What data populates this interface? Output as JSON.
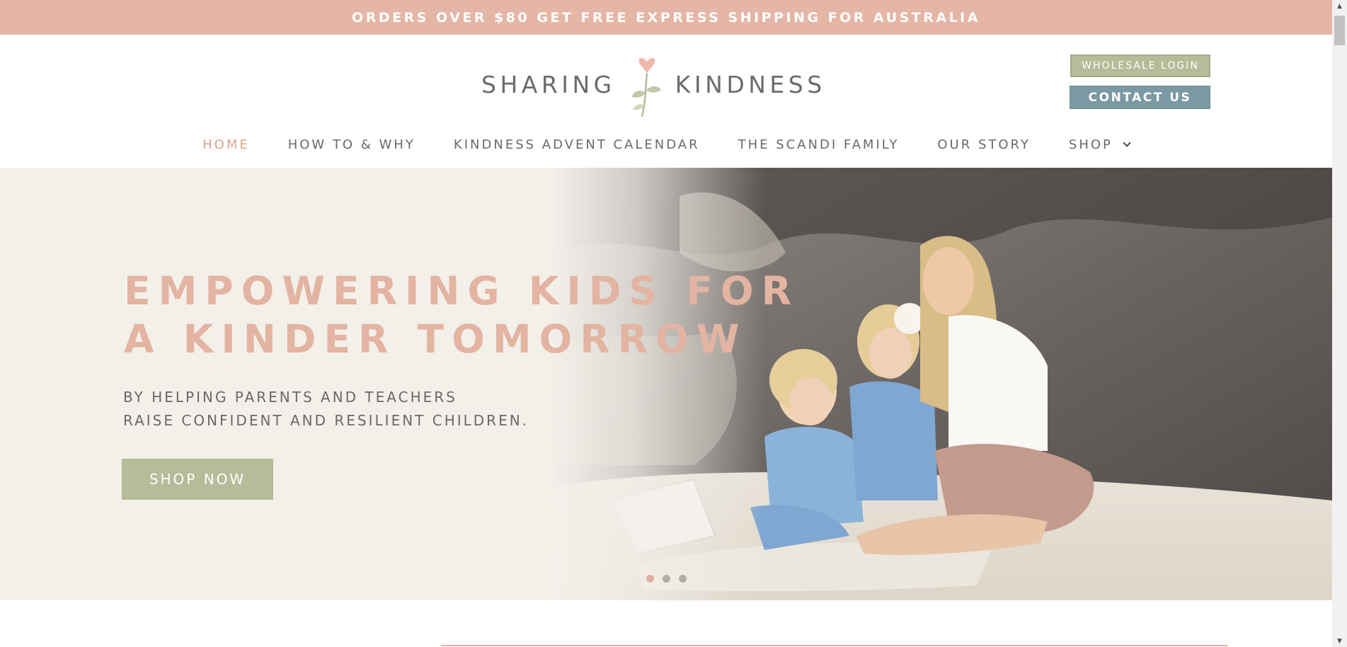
{
  "announcement": {
    "text": "ORDERS OVER $80 GET FREE EXPRESS SHIPPING FOR AUSTRALIA"
  },
  "header": {
    "logo": {
      "word_left": "SHARING",
      "word_right": "KINDNESS"
    },
    "wholesale_label": "WHOLESALE LOGIN",
    "contact_label": "CONTACT US"
  },
  "nav": {
    "items": [
      {
        "label": "HOME",
        "active": true
      },
      {
        "label": "HOW TO & WHY"
      },
      {
        "label": "KINDNESS ADVENT CALENDAR"
      },
      {
        "label": "THE SCANDI FAMILY"
      },
      {
        "label": "OUR STORY"
      },
      {
        "label": "SHOP",
        "icon": "chevron-down-icon"
      }
    ]
  },
  "hero": {
    "title_line1": "EMPOWERING KIDS FOR",
    "title_line2": "A KINDER TOMORROW",
    "subtitle_line1": "BY HELPING PARENTS AND TEACHERS",
    "subtitle_line2": "RAISE CONFIDENT AND RESILIENT CHILDREN.",
    "cta_label": "SHOP NOW",
    "slides": 3,
    "active_slide": 1
  },
  "colors": {
    "accent_pink": "#e3b4a2",
    "accent_sage": "#b6bb98",
    "accent_slate": "#7b99a3",
    "text_grey": "#6b6869",
    "hero_bg": "#f3f0ea"
  }
}
